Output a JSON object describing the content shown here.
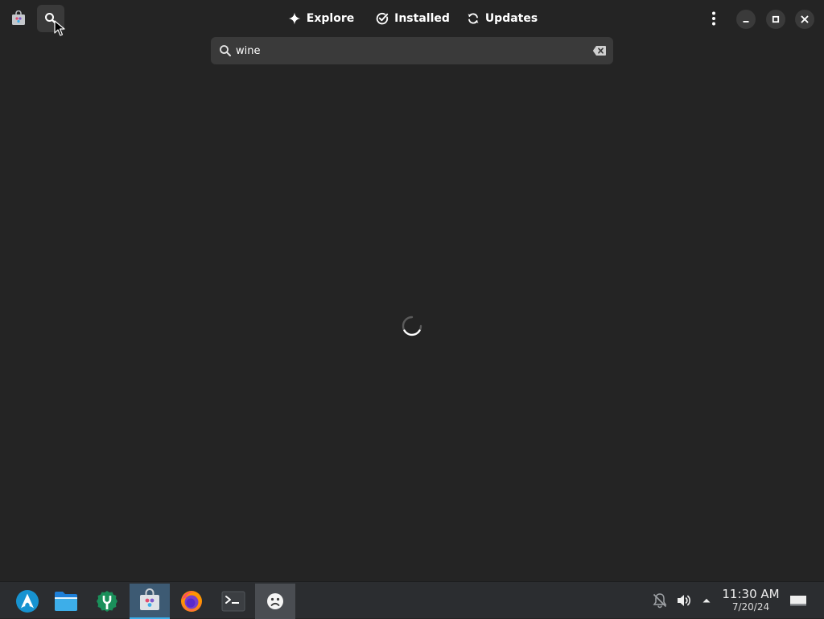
{
  "header": {
    "tabs": [
      {
        "label": "Explore",
        "icon": "sparkle-icon"
      },
      {
        "label": "Installed",
        "icon": "check-circle-icon"
      },
      {
        "label": "Updates",
        "icon": "refresh-icon"
      }
    ],
    "app_icon": "software-bag-icon",
    "search_toggle_icon": "search-icon",
    "menu_icon": "kebab-menu-icon",
    "window_controls": [
      "minimize-icon",
      "maximize-icon",
      "close-icon"
    ]
  },
  "search": {
    "value": "wine",
    "icon": "search-icon",
    "clear_icon": "backspace-clear-icon"
  },
  "content": {
    "state": "loading",
    "spinner_icon": "spinner-icon"
  },
  "taskbar": {
    "launchers": [
      {
        "name": "application-launcher",
        "icon": "arch-logo-icon"
      },
      {
        "name": "files",
        "icon": "folder-icon"
      },
      {
        "name": "system-tool",
        "icon": "green-gear-icon"
      },
      {
        "name": "software",
        "icon": "software-bag-icon",
        "state": "active"
      },
      {
        "name": "firefox",
        "icon": "firefox-icon"
      },
      {
        "name": "terminal",
        "icon": "terminal-icon"
      },
      {
        "name": "open-window",
        "icon": "sad-face-icon",
        "state": "open"
      }
    ],
    "tray": {
      "icons": [
        "notifications-muted-icon",
        "volume-icon",
        "tray-expand-arrow-icon",
        "show-desktop-icon"
      ],
      "time": "11:30 AM",
      "date": "7/20/24"
    }
  },
  "colors": {
    "background": "#242424",
    "button_bg": "#3a3a3a",
    "taskbar_bg": "#2b2d30",
    "active_task": "#3d5a73",
    "accent": "#3daee9"
  }
}
